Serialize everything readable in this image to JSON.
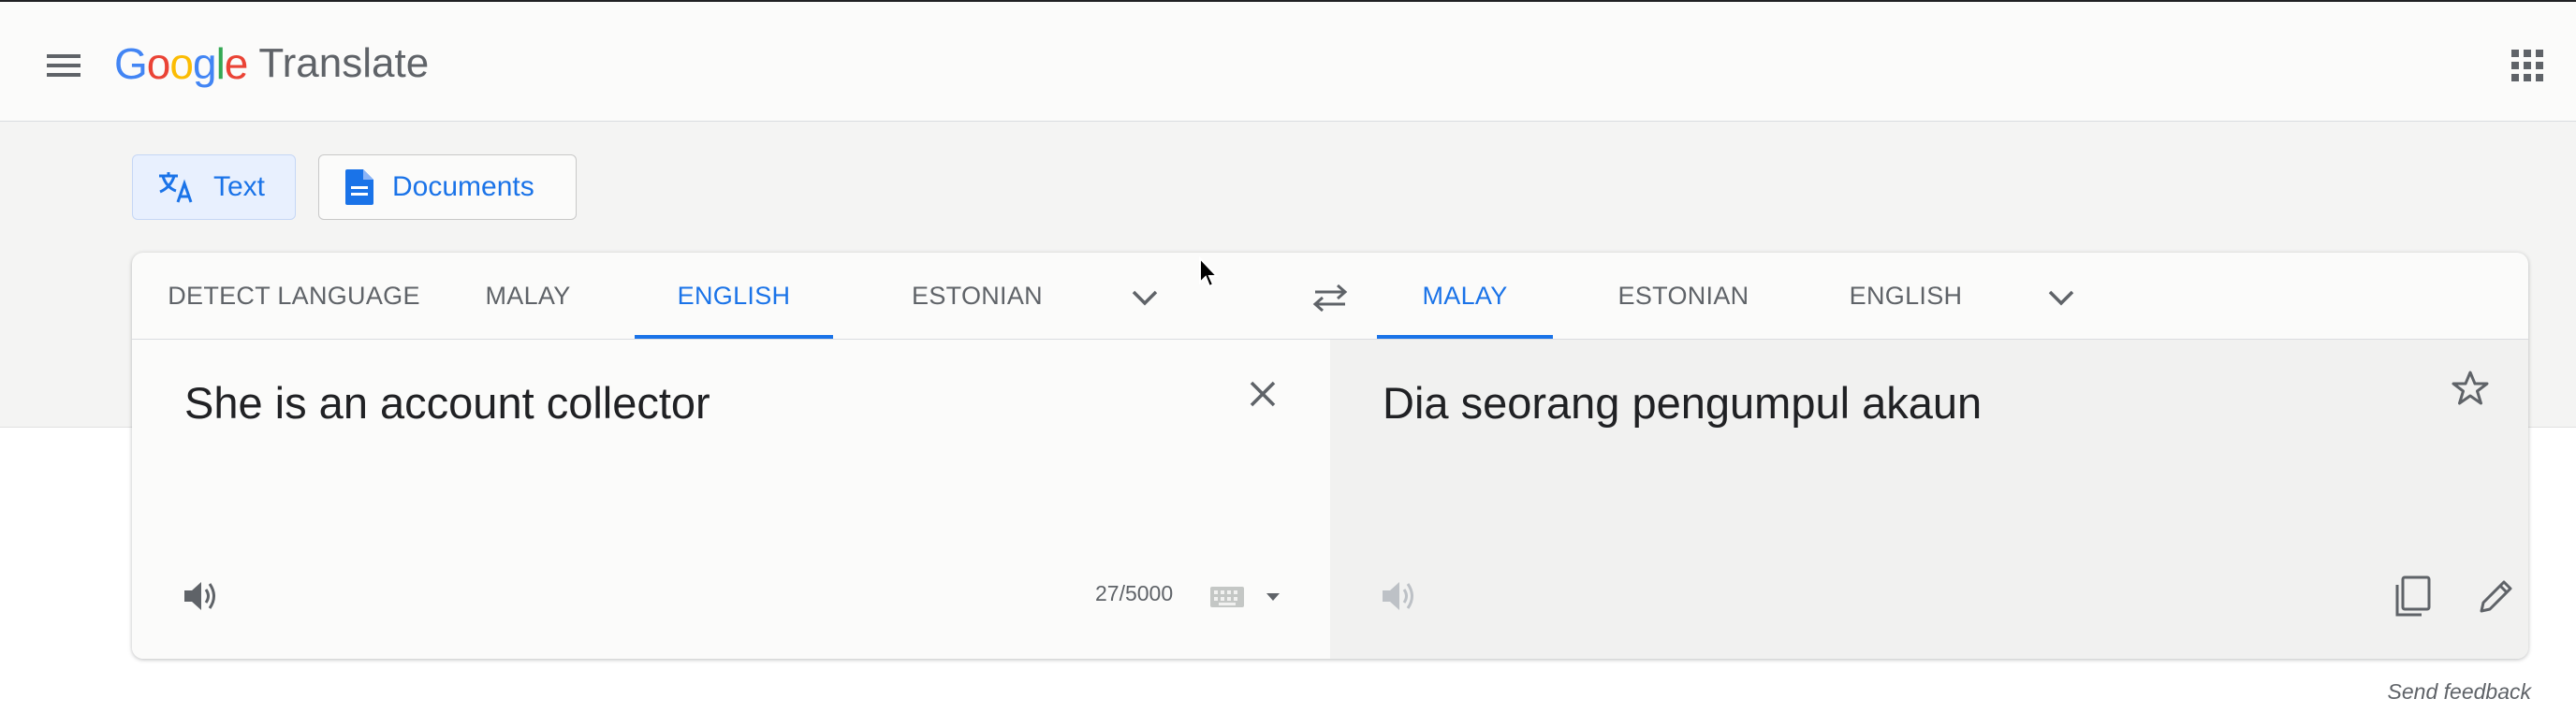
{
  "header": {
    "logo_letters": [
      {
        "ch": "G",
        "color": "#4285f4"
      },
      {
        "ch": "o",
        "color": "#ea4335"
      },
      {
        "ch": "o",
        "color": "#fbbc04"
      },
      {
        "ch": "g",
        "color": "#4285f4"
      },
      {
        "ch": "l",
        "color": "#34a853"
      },
      {
        "ch": "e",
        "color": "#ea4335"
      }
    ],
    "product": "Translate",
    "menu_icon": "hamburger-menu-icon",
    "apps_icon": "apps-grid-icon"
  },
  "modes": {
    "text_label": "Text",
    "documents_label": "Documents",
    "active": "Text"
  },
  "source": {
    "tabs": [
      "DETECT LANGUAGE",
      "MALAY",
      "ENGLISH",
      "ESTONIAN"
    ],
    "active_tab": "ENGLISH",
    "text": "She is an account collector",
    "char_count": "27/5000"
  },
  "target": {
    "tabs": [
      "MALAY",
      "ESTONIAN",
      "ENGLISH"
    ],
    "active_tab": "MALAY",
    "text": "Dia seorang pengumpul akaun"
  },
  "footer": {
    "feedback": "Send feedback"
  },
  "colors": {
    "accent": "#1a73e8",
    "text_primary": "#202124",
    "text_secondary": "#5f6368"
  }
}
